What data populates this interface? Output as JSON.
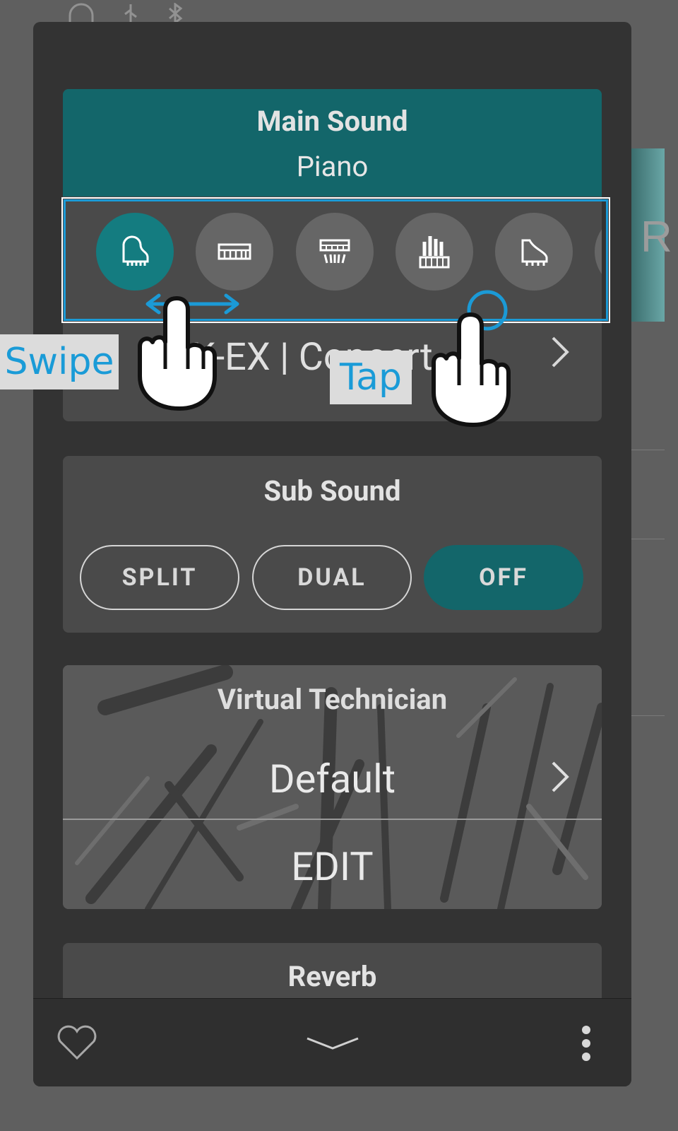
{
  "statusbar": {
    "icons": [
      "headphones-icon",
      "usb-icon",
      "bluetooth-icon"
    ]
  },
  "background": {
    "partial_letter": "R"
  },
  "main_sound": {
    "title": "Main Sound",
    "category": "Piano",
    "category_icons": [
      {
        "name": "grand-piano-icon",
        "active": true
      },
      {
        "name": "electric-piano-icon",
        "active": false
      },
      {
        "name": "vintage-keyboard-icon",
        "active": false
      },
      {
        "name": "organ-icon",
        "active": false
      },
      {
        "name": "harpsichord-icon",
        "active": false
      },
      {
        "name": "more-category-icon",
        "active": false
      }
    ],
    "variation": "SK-EX | Concert"
  },
  "sub_sound": {
    "title": "Sub Sound",
    "options": [
      "SPLIT",
      "DUAL",
      "OFF"
    ],
    "selected": "OFF"
  },
  "virtual_technician": {
    "title": "Virtual Technician",
    "value": "Default",
    "edit_label": "EDIT"
  },
  "reverb": {
    "title": "Reverb"
  },
  "bottom_bar": {
    "icons": [
      "favorite-heart-icon",
      "collapse-chevron-icon",
      "more-vert-icon"
    ]
  },
  "tutorial": {
    "swipe_label": "Swipe",
    "tap_label": "Tap"
  },
  "colors": {
    "accent_teal": "#13666a",
    "active_teal": "#147c80",
    "tutorial_blue": "#1b9ad6",
    "panel": "#333333",
    "card": "#4a4a4a"
  }
}
